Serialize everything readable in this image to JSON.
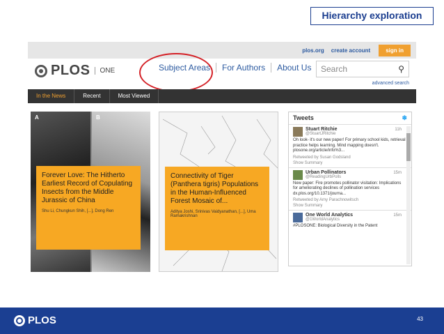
{
  "slide_title": "Hierarchy exploration",
  "top_links": [
    "plos.org",
    "create account"
  ],
  "sign_in": "sign in",
  "logo": {
    "brand": "PLOS",
    "sub": "ONE"
  },
  "nav": [
    "Subject Areas",
    "For Authors",
    "About Us"
  ],
  "search": {
    "placeholder": "Search",
    "advanced": "advanced search"
  },
  "tabs": [
    "In the News",
    "Recent",
    "Most Viewed"
  ],
  "cards": [
    {
      "tag_a": "A",
      "tag_b": "B",
      "title": "Forever Love: The Hitherto Earliest Record of Copulating Insects from the Middle Jurassic of China",
      "authors": "Shu Li, Chungkun Shih, [...], Dong Ren"
    },
    {
      "title": "Connectivity of Tiger (Panthera tigris) Populations in the Human-Influenced Forest Mosaic of...",
      "authors": "Aditya Joshi, Srinivas Vaidyanathan, [...], Uma Ramakrishnan"
    }
  ],
  "tweets_header": "Tweets",
  "tweets": [
    {
      "name": "Stuart Ritchie",
      "handle": "@StuartJRitchie",
      "time": "11h",
      "body": "Oh look- it's our new paper! For primary school kids, retrieval practice helps learning. Mind mapping doesn't. plosone.org/article/info%3...",
      "meta": "Retweeted by Susan Godsland",
      "summary": "Show Summary"
    },
    {
      "name": "Urban Pollinators",
      "handle": "@ReadingUrbPolls",
      "time": "15m",
      "body": "New paper: Fire promotes pollinator visitation: Implications for ameliorating declines of pollination services dx.plos.org/10.1371/journa...",
      "meta": "Retweeted by Amy Parachnowitsch",
      "summary": "Show Summary"
    },
    {
      "name": "One World Analytics",
      "handle": "@1WorldAnalytics",
      "time": "15m",
      "body": "#PLOSONE: Biological Diversity in the Patent",
      "meta": "",
      "summary": ""
    }
  ],
  "footer": {
    "brand": "PLOS",
    "page": "43"
  },
  "colors": {
    "accent": "#f7a823",
    "footer": "#1b3f92",
    "highlight": "#d42026"
  }
}
